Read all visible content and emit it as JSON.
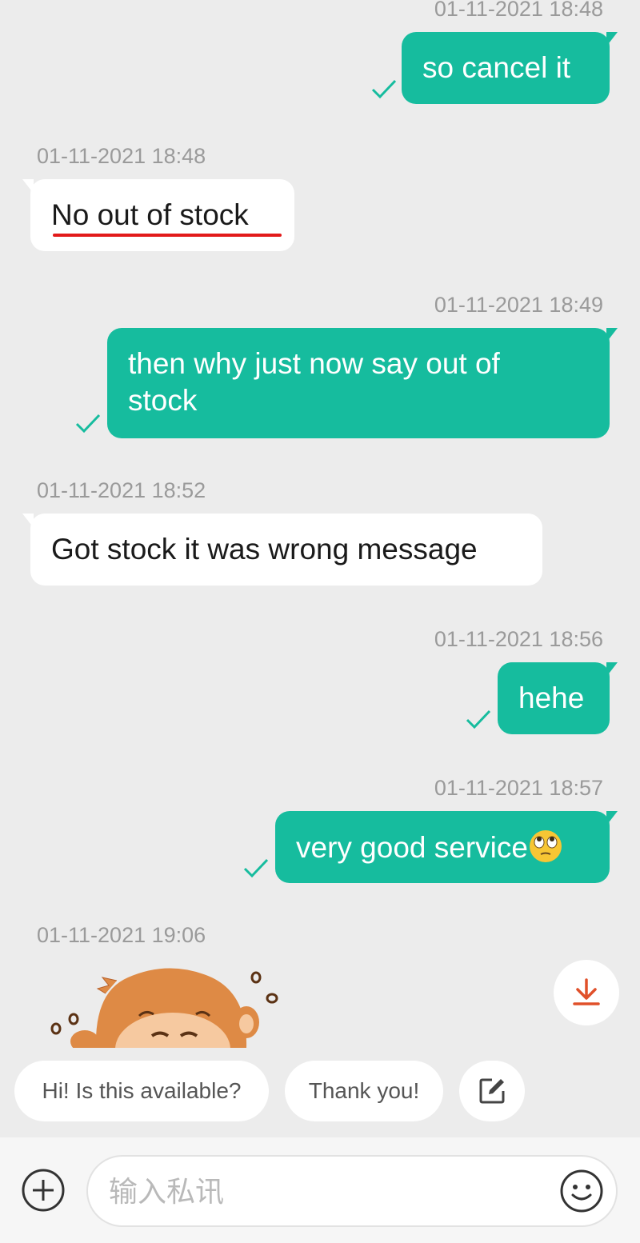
{
  "messages": [
    {
      "side": "out",
      "timestamp": "01-11-2021 18:48",
      "text": "so cancel it"
    },
    {
      "side": "in",
      "timestamp": "01-11-2021 18:48",
      "text": "No out of stock"
    },
    {
      "side": "out",
      "timestamp": "01-11-2021 18:49",
      "text_line1": "then why just now say out of",
      "text_line2": "stock"
    },
    {
      "side": "in",
      "timestamp": "01-11-2021 18:52",
      "text": "Got stock it was wrong message"
    },
    {
      "side": "out",
      "timestamp": "01-11-2021 18:56",
      "text": "hehe"
    },
    {
      "side": "out",
      "timestamp": "01-11-2021 18:57",
      "text": "very good service",
      "emoji": "face-with-rolling-eyes"
    },
    {
      "side": "in",
      "timestamp": "01-11-2021 19:06",
      "sticker": "monkey-sticker"
    }
  ],
  "quick_replies": [
    "Hi! Is this available?",
    "Thank you!"
  ],
  "composer": {
    "placeholder": "输入私讯"
  },
  "colors": {
    "outgoing": "#16bc9e",
    "incoming": "#ffffff",
    "background": "#ececec",
    "accent_download": "#e0502a",
    "highlight_underline": "#e21a1a"
  },
  "icons": [
    "read-check-icon",
    "download-icon",
    "edit-icon",
    "plus-icon",
    "smiley-icon"
  ]
}
